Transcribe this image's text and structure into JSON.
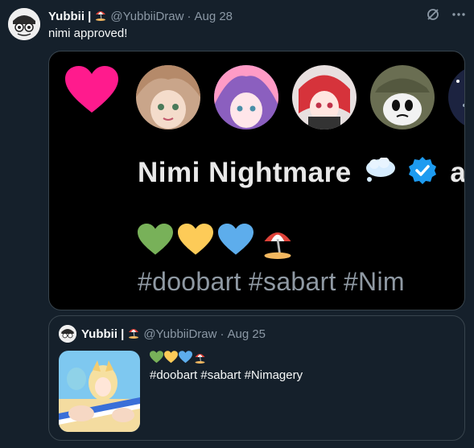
{
  "tweet": {
    "author_name": "Yubbii |",
    "handle": "@YubbiiDraw",
    "separator": "·",
    "date": "Aug 28",
    "text": "nimi approved!"
  },
  "media": {
    "display_name": "Nimi Nightmare",
    "hashtags_text": "#doobart #sabart #Nim"
  },
  "quote": {
    "author_name": "Yubbii |",
    "handle": "@YubbiiDraw",
    "separator": "·",
    "date": "Aug 25",
    "hashtags_text": "#doobart #sabart #Nimagery"
  },
  "colors": {
    "heart_pink": "#ff1b8d",
    "verified_blue": "#1d9bf0",
    "green_heart": "#78b159",
    "yellow_heart": "#fdcb58",
    "blue_heart": "#5dadec"
  },
  "icons": [
    "grok-icon",
    "more-icon",
    "verified-badge-icon",
    "beach-umbrella-icon",
    "thought-bubble-icon"
  ]
}
